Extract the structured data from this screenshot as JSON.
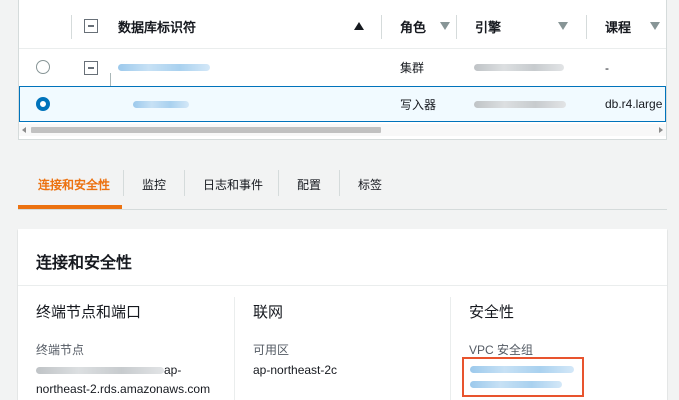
{
  "table": {
    "columns": {
      "identifier": "数据库标识符",
      "role": "角色",
      "engine": "引擎",
      "class": "课程"
    },
    "rows": [
      {
        "role": "集群",
        "class": "-"
      },
      {
        "role": "写入器",
        "class": "db.r4.large"
      }
    ]
  },
  "tabs": [
    "连接和安全性",
    "监控",
    "日志和事件",
    "配置",
    "标签"
  ],
  "panel": {
    "title": "连接和安全性",
    "endpoint": {
      "heading": "终端节点和端口",
      "label": "终端节点",
      "value_line1_suffix": "ap-",
      "value_line2": "northeast-2.rds.amazonaws.com"
    },
    "network": {
      "heading": "联网",
      "label": "可用区",
      "value": "ap-northeast-2c"
    },
    "security": {
      "heading": "安全性",
      "label": "VPC 安全组"
    }
  },
  "colors": {
    "accent": "#ec7211",
    "selection": "#0073bb",
    "highlight": "#e8542e"
  }
}
